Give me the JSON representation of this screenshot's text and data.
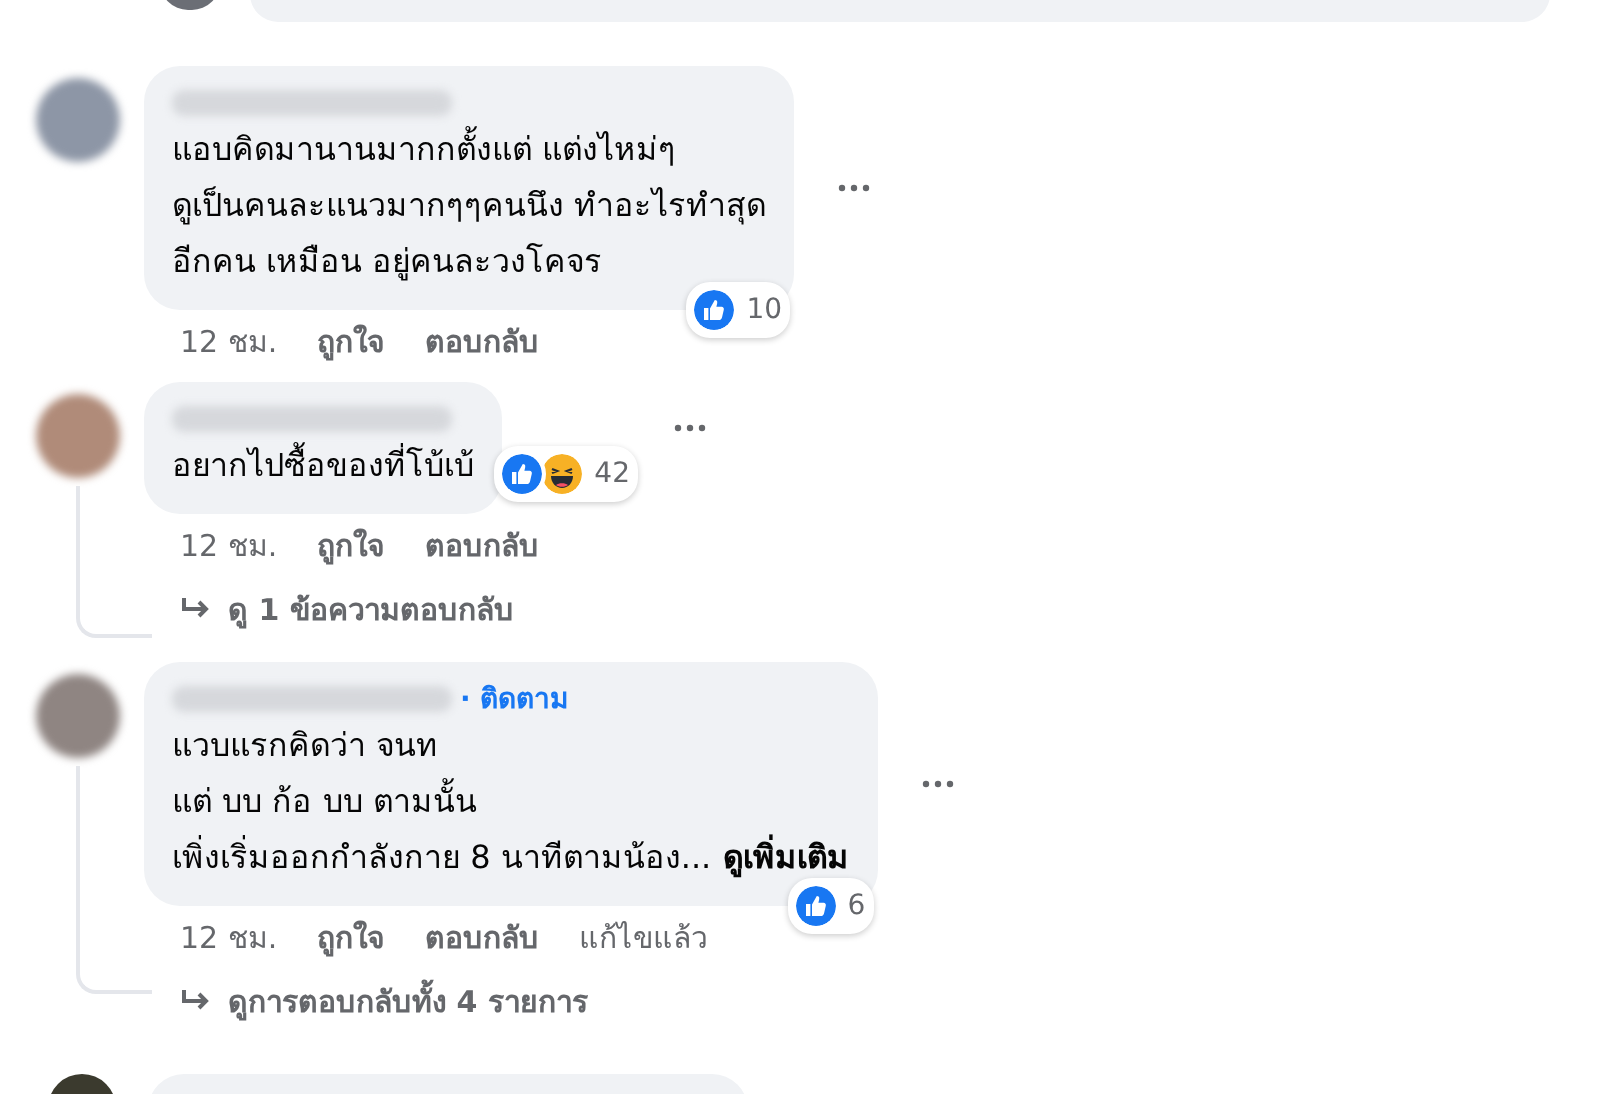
{
  "comments": [
    {
      "lines": [
        "แอบคิดมานานมากกตั้งแต่ แต่งไหม่ๆ",
        "ดูเป็นคนละแนวมากๆๆคนนึง ทำอะไรทำสุด",
        "อีกคน เหมือน อยู่คนละวงโคจร"
      ],
      "reactions": [
        {
          "kind": "like"
        }
      ],
      "reaction_count": "10",
      "actions": {
        "time": "12 ชม.",
        "like": "ถูกใจ",
        "reply": "ตอบกลับ"
      }
    },
    {
      "lines": [
        "อยากไปซื้อของที่โบ้เบ้"
      ],
      "reactions": [
        {
          "kind": "like"
        },
        {
          "kind": "haha"
        }
      ],
      "reaction_count": "42",
      "actions": {
        "time": "12 ชม.",
        "like": "ถูกใจ",
        "reply": "ตอบกลับ"
      },
      "view_replies": "ดู 1 ข้อความตอบกลับ"
    },
    {
      "follow": "· ติดตาม",
      "lines": [
        "แวบแรกคิดว่า จนท",
        "แต่ บบ ก้อ บบ ตามนั้น",
        "เพิ่งเริ่มออกกำลังกาย 8 นาทีตามน้อง..."
      ],
      "see_more": "ดูเพิ่มเติม",
      "reactions": [
        {
          "kind": "like"
        }
      ],
      "reaction_count": "6",
      "actions": {
        "time": "12 ชม.",
        "like": "ถูกใจ",
        "reply": "ตอบกลับ",
        "edited": "แก้ไขแล้ว"
      },
      "view_replies": "ดูการตอบกลับทั้ง 4 รายการ"
    }
  ]
}
